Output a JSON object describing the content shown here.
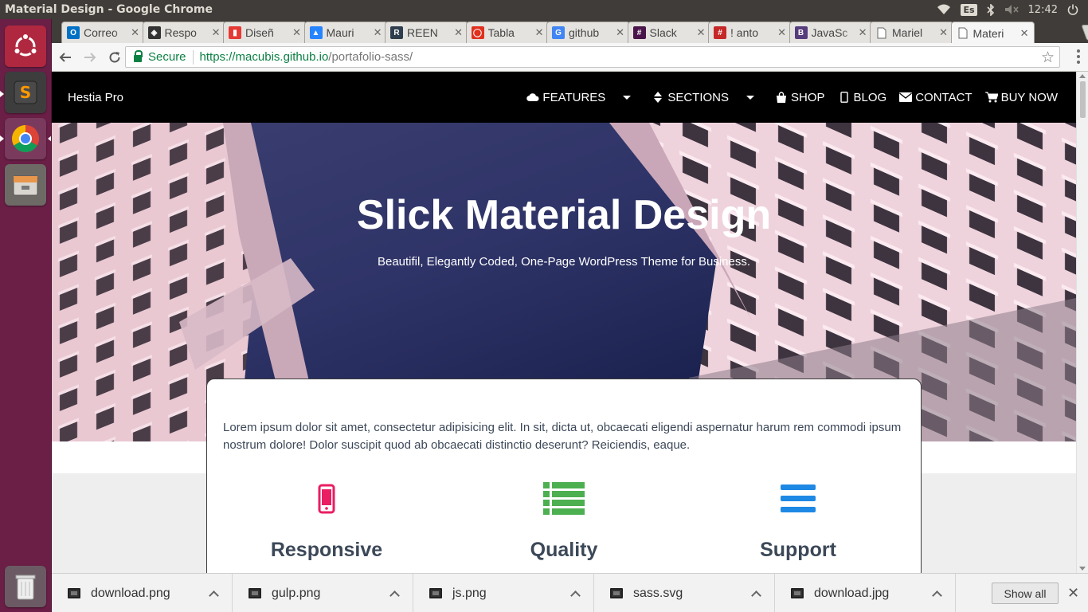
{
  "os": {
    "window_title": "Material Design - Google Chrome",
    "keyboard_layout": "Es",
    "clock": "12:42"
  },
  "tabs": [
    {
      "label": "Correo",
      "favicon": "outlook-icon",
      "color": "#0072c6",
      "glyph": "O"
    },
    {
      "label": "Respo",
      "favicon": "codepen-icon",
      "color": "#333333",
      "glyph": "◈"
    },
    {
      "label": "Diseñ",
      "favicon": "dropbox-paper-icon",
      "color": "#e53935",
      "glyph": "▮"
    },
    {
      "label": "Mauri",
      "favicon": "atlassian-icon",
      "color": "#2684ff",
      "glyph": "▲"
    },
    {
      "label": "REEN",
      "favicon": "reen-icon",
      "color": "#2f3e4e",
      "glyph": "R"
    },
    {
      "label": "Tabla",
      "favicon": "opera-icon",
      "color": "#e0301e",
      "glyph": "◯"
    },
    {
      "label": "github",
      "favicon": "google-icon",
      "color": "#4285f4",
      "glyph": "G"
    },
    {
      "label": "Slack",
      "favicon": "slack-icon",
      "color": "#4a154b",
      "glyph": "#"
    },
    {
      "label": "! anto",
      "favicon": "hashtag-icon",
      "color": "#c62828",
      "glyph": "#"
    },
    {
      "label": "JavaSc",
      "favicon": "bootstrap-icon",
      "color": "#563d7c",
      "glyph": "B"
    },
    {
      "label": "Mariel",
      "favicon": "document-icon",
      "color": "#9e9e9e",
      "glyph": ""
    },
    {
      "label": "Materi",
      "favicon": "document-icon",
      "color": "#9e9e9e",
      "glyph": "",
      "active": true
    }
  ],
  "omnibox": {
    "secure_label": "Secure",
    "url_main": "https://macubis.github.io",
    "url_path": "/portafolio-sass/"
  },
  "site": {
    "brand": "Hestia Pro",
    "menu": [
      {
        "label": "FEATURES",
        "icon": "cloud-icon",
        "has_dropdown": true
      },
      {
        "label": "SECTIONS",
        "icon": "sort-icon",
        "has_dropdown": true
      },
      {
        "label": "SHOP",
        "icon": "shopping-bag-icon",
        "has_dropdown": false
      },
      {
        "label": "BLOG",
        "icon": "mobile-icon",
        "has_dropdown": false
      },
      {
        "label": "CONTACT",
        "icon": "envelope-icon",
        "has_dropdown": false
      },
      {
        "label": "BUY NOW",
        "icon": "cart-icon",
        "has_dropdown": false
      }
    ],
    "hero_title": "Slick Material Design",
    "hero_subtitle": "Beautifil, Elegantly Coded, One-Page WordPress Theme for Business.",
    "card_lead": "Lorem ipsum dolor sit amet, consectetur adipisicing elit. In sit, dicta ut, obcaecati eligendi aspernatur harum rem commodi ipsum nostrum dolore! Dolor suscipit quod ab obcaecati distinctio deserunt? Reiciendis, eaque.",
    "features": [
      {
        "title": "Responsive",
        "icon": "mobile-phone-icon",
        "color": "#e91e63"
      },
      {
        "title": "Quality",
        "icon": "list-icon",
        "color": "#4caf50"
      },
      {
        "title": "Support",
        "icon": "bars-icon",
        "color": "#1e88e5"
      }
    ]
  },
  "downloads": {
    "items": [
      "download.png",
      "gulp.png",
      "js.png",
      "sass.svg",
      "download.jpg"
    ],
    "show_all_label": "Show all"
  }
}
